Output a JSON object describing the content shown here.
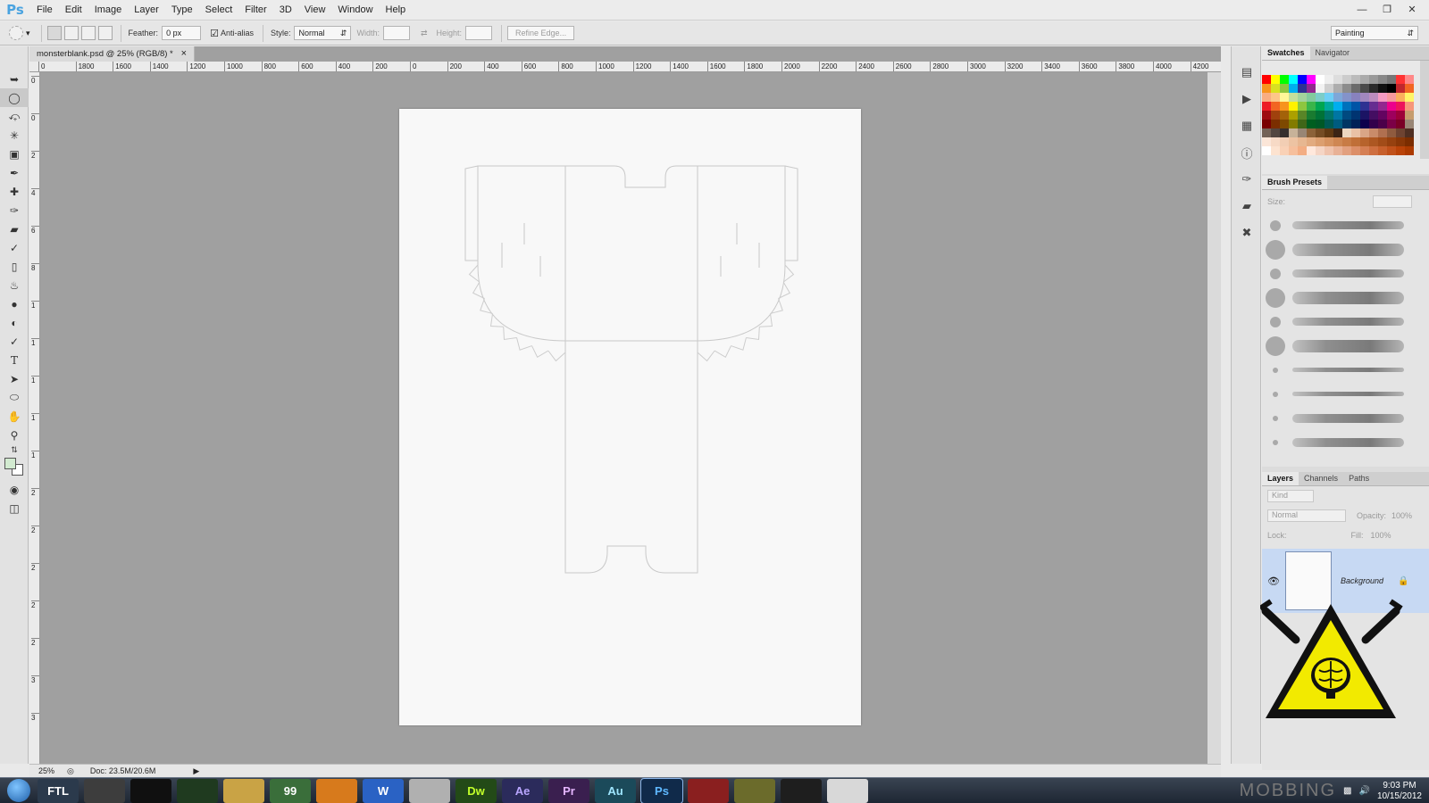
{
  "menubar": {
    "logo": "Ps",
    "items": [
      "File",
      "Edit",
      "Image",
      "Layer",
      "Type",
      "Select",
      "Filter",
      "3D",
      "View",
      "Window",
      "Help"
    ]
  },
  "options": {
    "feather_label": "Feather:",
    "feather_value": "0 px",
    "antialias_label": "Anti-alias",
    "antialias_checked": true,
    "style_label": "Style:",
    "style_value": "Normal",
    "width_label": "Width:",
    "height_label": "Height:",
    "refine_label": "Refine Edge...",
    "workspace": "Painting"
  },
  "document": {
    "tab_title": "monsterblank.psd @ 25% (RGB/8) *",
    "close": "×",
    "ruler_top": [
      "0",
      "1800",
      "1600",
      "1400",
      "1200",
      "1000",
      "800",
      "600",
      "400",
      "200",
      "0",
      "200",
      "400",
      "600",
      "800",
      "1000",
      "1200",
      "1400",
      "1600",
      "1800",
      "2000",
      "2200",
      "2400",
      "2600",
      "2800",
      "3000",
      "3200",
      "3400",
      "3600",
      "3800",
      "4000",
      "4200"
    ],
    "ruler_left": [
      "0",
      "0",
      "2",
      "4",
      "6",
      "8",
      "1",
      "1",
      "1",
      "1",
      "1",
      "2",
      "2",
      "2",
      "2",
      "2",
      "3",
      "3"
    ],
    "zoom": "25%",
    "doc_size": "Doc: 23.5M/20.6M"
  },
  "panels": {
    "swatches": {
      "tab": "Swatches",
      "tab2": "Navigator"
    },
    "brush": {
      "title": "Brush Presets",
      "size_label": "Size:"
    },
    "layers": {
      "tabs": [
        "Layers",
        "Channels",
        "Paths"
      ],
      "kind_label": "Kind",
      "blend": "Normal",
      "opacity_label": "Opacity:",
      "opacity_value": "100%",
      "lock_label": "Lock:",
      "fill_label": "Fill:",
      "fill_value": "100%",
      "layer_name": "Background"
    }
  },
  "taskbar": {
    "apps": [
      "FTL",
      "",
      "",
      "",
      "",
      "99",
      "",
      "W",
      "",
      "Dw",
      "Ae",
      "Pr",
      "Au",
      "Ps",
      "",
      "",
      "",
      ""
    ],
    "tray_time": "9:03 PM",
    "tray_date": "10/15/2012",
    "watermark": "MOBBING"
  },
  "colors": {
    "accent": "#4aa3e0",
    "layer_selected": "#c7d9f3",
    "hazard_yellow": "#f2ea00"
  }
}
